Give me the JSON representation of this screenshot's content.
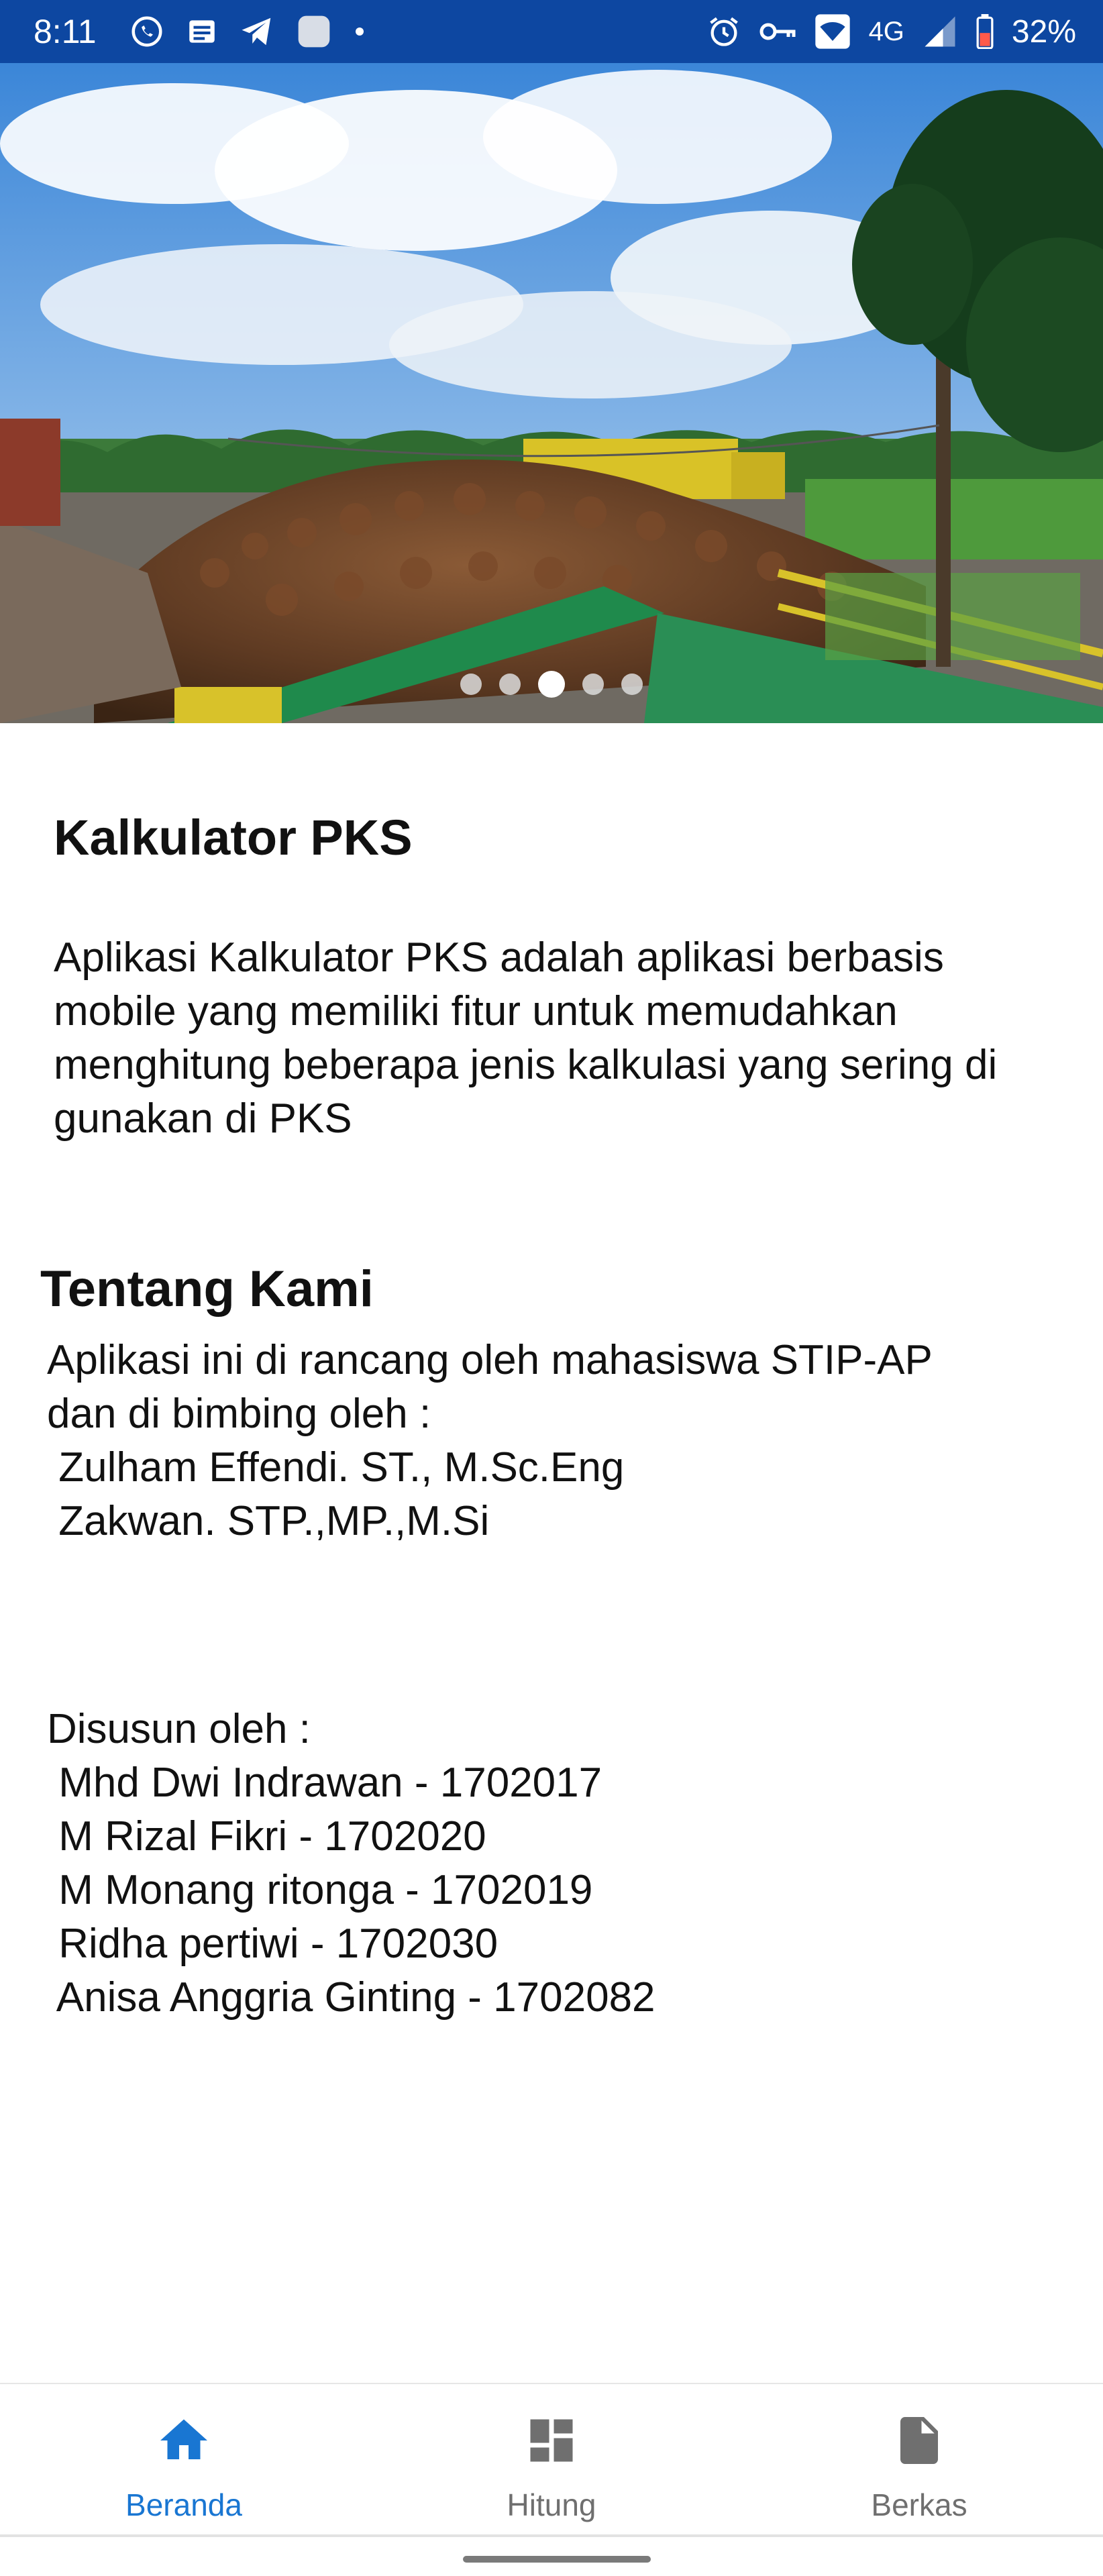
{
  "status_bar": {
    "time": "8:11",
    "network": "4G",
    "battery": "32%",
    "icons": [
      "whatsapp-icon",
      "news-icon",
      "telegram-icon",
      "app-icon",
      "dot-icon",
      "alarm-icon",
      "vpn-key-icon",
      "wifi-icon",
      "signal-icon",
      "battery-icon"
    ]
  },
  "carousel": {
    "dot_count": 5,
    "active_index": 2
  },
  "intro": {
    "title": "Kalkulator PKS",
    "description": "Aplikasi Kalkulator PKS adalah aplikasi berbasis mobile yang memiliki fitur untuk memudahkan menghitung beberapa jenis kalkulasi yang sering di gunakan di PKS"
  },
  "about": {
    "title": "Tentang Kami",
    "lines": [
      "Aplikasi ini di rancang oleh mahasiswa STIP-AP",
      "dan di bimbing oleh :",
      " Zulham Effendi. ST., M.Sc.Eng",
      " Zakwan. STP.,MP.,M.Si"
    ]
  },
  "authors": {
    "lines": [
      "Disusun oleh :",
      " Mhd Dwi Indrawan - 1702017",
      " M Rizal Fikri - 1702020",
      " M Monang ritonga - 1702019",
      " Ridha pertiwi - 1702030",
      " Anisa Anggria Ginting - 1702082"
    ]
  },
  "bottom_nav": {
    "items": [
      {
        "label": "Beranda",
        "icon": "home-icon",
        "active": true
      },
      {
        "label": "Hitung",
        "icon": "dashboard-icon",
        "active": false
      },
      {
        "label": "Berkas",
        "icon": "file-icon",
        "active": false
      }
    ]
  },
  "colors": {
    "status_bar": "#0d47a1",
    "accent": "#1976d2",
    "inactive": "#6f6f6f",
    "text": "#111111"
  }
}
